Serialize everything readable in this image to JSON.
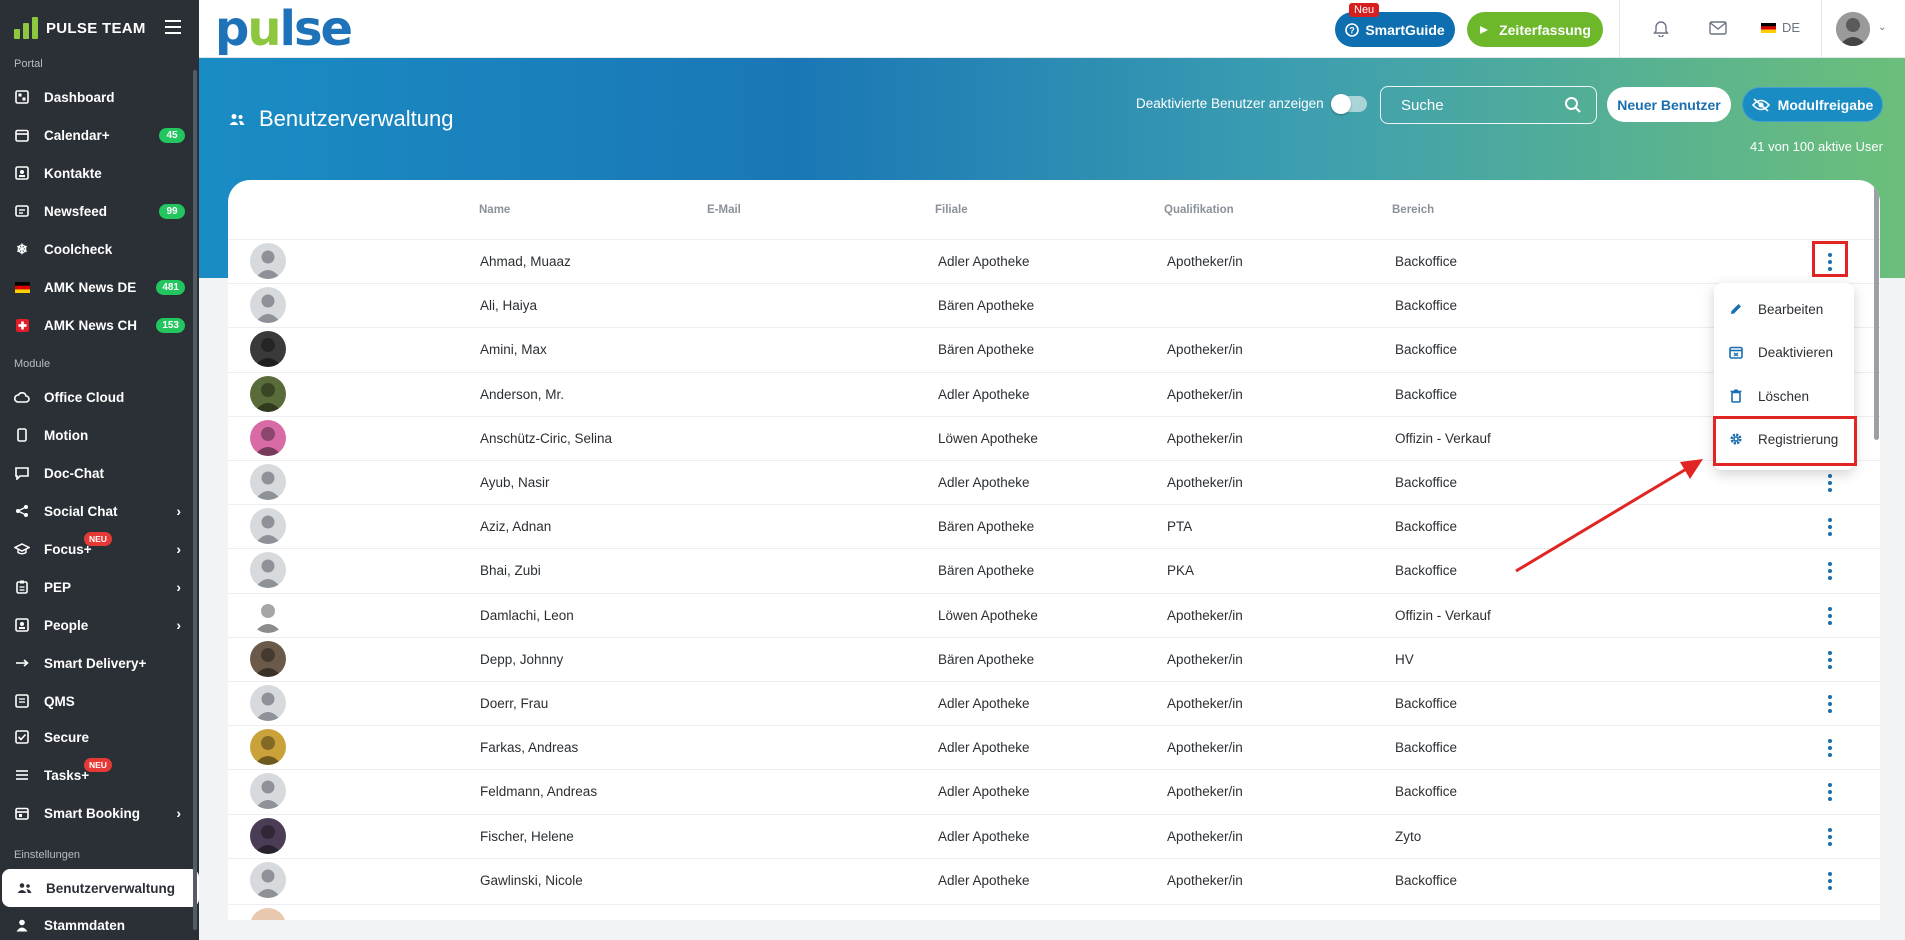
{
  "sidebar": {
    "brand": "PULSE TEAM",
    "sections": {
      "portal": "Portal",
      "module": "Module",
      "einstellungen": "Einstellungen"
    },
    "items": [
      {
        "label": "Dashboard",
        "icon": "dashboard-icon"
      },
      {
        "label": "Calendar+",
        "icon": "calendar-icon",
        "badge": "45"
      },
      {
        "label": "Kontakte",
        "icon": "contacts-icon"
      },
      {
        "label": "Newsfeed",
        "icon": "newsfeed-icon",
        "badge": "99"
      },
      {
        "label": "Coolcheck",
        "icon": "snowflake-icon"
      },
      {
        "label": "AMK News DE",
        "icon": "flag-de-icon",
        "badge": "481"
      },
      {
        "label": "AMK News CH",
        "icon": "flag-ch-icon",
        "badge": "153"
      },
      {
        "label": "Office Cloud",
        "icon": "cloud-icon"
      },
      {
        "label": "Motion",
        "icon": "phone-icon"
      },
      {
        "label": "Doc-Chat",
        "icon": "chat-icon"
      },
      {
        "label": "Social Chat",
        "icon": "share-icon"
      },
      {
        "label": "Focus+",
        "icon": "graduation-icon",
        "tag": "NEU"
      },
      {
        "label": "PEP",
        "icon": "clipboard-icon"
      },
      {
        "label": "People",
        "icon": "id-card-icon"
      },
      {
        "label": "Smart Delivery+",
        "icon": "arrow-right-icon"
      },
      {
        "label": "QMS",
        "icon": "document-icon"
      },
      {
        "label": "Secure",
        "icon": "check-square-icon"
      },
      {
        "label": "Tasks+",
        "icon": "list-icon",
        "tag": "NEU"
      },
      {
        "label": "Smart Booking",
        "icon": "calendar-check-icon"
      },
      {
        "label": "Benutzerverwaltung",
        "icon": "users-icon"
      },
      {
        "label": "Stammdaten",
        "icon": "person-icon"
      }
    ]
  },
  "topbar": {
    "logo": {
      "p": "p",
      "u": "u",
      "lse": "lse"
    },
    "smartguide": {
      "label": "SmartGuide",
      "tag": "Neu"
    },
    "zeiterfassung": "Zeiterfassung",
    "language": "DE"
  },
  "page": {
    "title": "Benutzerverwaltung",
    "toggle_label": "Deaktivierte Benutzer anzeigen",
    "search_placeholder": "Suche",
    "new_user": "Neuer Benutzer",
    "modulfreigabe": "Modulfreigabe",
    "user_count": "41 von 100 aktive User"
  },
  "table": {
    "headers": {
      "name": "Name",
      "email": "E-Mail",
      "filiale": "Filiale",
      "qualifikation": "Qualifikation",
      "bereich": "Bereich"
    },
    "rows": [
      {
        "name": "Ahmad, Muaaz",
        "email": "",
        "filiale": "Adler Apotheke",
        "qualifikation": "Apotheker/in",
        "bereich": "Backoffice",
        "avatar": "placeholder"
      },
      {
        "name": "Ali, Haiya",
        "email": "",
        "filiale": "Bären Apotheke",
        "qualifikation": "",
        "bereich": "Backoffice",
        "avatar": "placeholder"
      },
      {
        "name": "Amini, Max",
        "email": "",
        "filiale": "Bären Apotheke",
        "qualifikation": "Apotheker/in",
        "bereich": "Backoffice",
        "avatar": "#3a3a3a"
      },
      {
        "name": "Anderson, Mr.",
        "email": "",
        "filiale": "Adler Apotheke",
        "qualifikation": "Apotheker/in",
        "bereich": "Backoffice",
        "avatar": "#5a6b3a"
      },
      {
        "name": "Anschütz-Ciric, Selina",
        "email": "",
        "filiale": "Löwen Apotheke",
        "qualifikation": "Apotheker/in",
        "bereich": "Offizin - Verkauf",
        "avatar": "#d86ba6"
      },
      {
        "name": "Ayub, Nasir",
        "email": "",
        "filiale": "Adler Apotheke",
        "qualifikation": "Apotheker/in",
        "bereich": "Backoffice",
        "avatar": "placeholder"
      },
      {
        "name": "Aziz, Adnan",
        "email": "",
        "filiale": "Bären Apotheke",
        "qualifikation": "PTA",
        "bereich": "Backoffice",
        "avatar": "placeholder"
      },
      {
        "name": "Bhai, Zubi",
        "email": "",
        "filiale": "Bären Apotheke",
        "qualifikation": "PKA",
        "bereich": "Backoffice",
        "avatar": "placeholder"
      },
      {
        "name": "Damlachi, Leon",
        "email": "",
        "filiale": "Löwen Apotheke",
        "qualifikation": "Apotheker/in",
        "bereich": "Offizin - Verkauf",
        "avatar": "#ffffff"
      },
      {
        "name": "Depp, Johnny",
        "email": "",
        "filiale": "Bären Apotheke",
        "qualifikation": "Apotheker/in",
        "bereich": "HV",
        "avatar": "#6b5a4a"
      },
      {
        "name": "Doerr, Frau",
        "email": "",
        "filiale": "Adler Apotheke",
        "qualifikation": "Apotheker/in",
        "bereich": "Backoffice",
        "avatar": "placeholder"
      },
      {
        "name": "Farkas, Andreas",
        "email": "",
        "filiale": "Adler Apotheke",
        "qualifikation": "Apotheker/in",
        "bereich": "Backoffice",
        "avatar": "#c9a23a"
      },
      {
        "name": "Feldmann, Andreas",
        "email": "",
        "filiale": "Adler Apotheke",
        "qualifikation": "Apotheker/in",
        "bereich": "Backoffice",
        "avatar": "placeholder"
      },
      {
        "name": "Fischer, Helene",
        "email": "",
        "filiale": "Adler Apotheke",
        "qualifikation": "Apotheker/in",
        "bereich": "Zyto",
        "avatar": "#4a3d55"
      },
      {
        "name": "Gawlinski, Nicole",
        "email": "",
        "filiale": "Adler Apotheke",
        "qualifikation": "Apotheker/in",
        "bereich": "Backoffice",
        "avatar": "placeholder"
      }
    ]
  },
  "menu": {
    "items": [
      {
        "label": "Bearbeiten",
        "icon": "pencil-icon"
      },
      {
        "label": "Deaktivieren",
        "icon": "calendar-x-icon"
      },
      {
        "label": "Löschen",
        "icon": "trash-icon"
      },
      {
        "label": "Registrierung",
        "icon": "gear-icon"
      }
    ]
  },
  "colors": {
    "accent": "#1a6fb0",
    "green": "#6cb82a",
    "sidebar": "#2b2f36",
    "highlight": "#e12424"
  }
}
